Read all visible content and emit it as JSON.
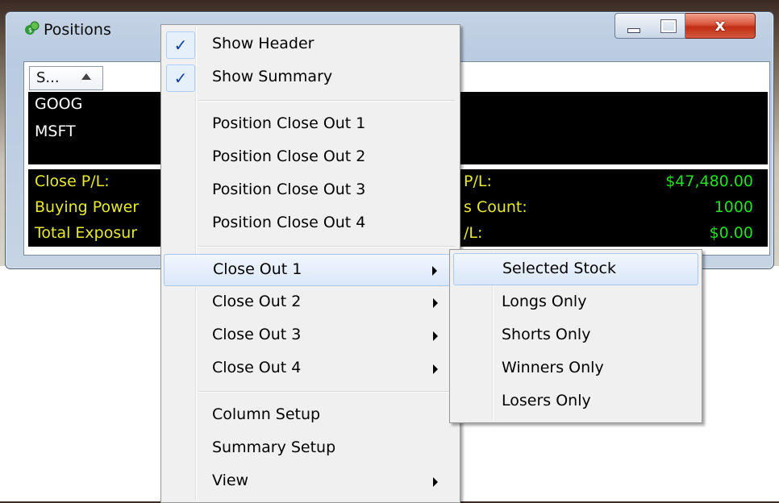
{
  "window": {
    "title": "Positions",
    "caption_close": "x",
    "column_header": "S...",
    "rows": [
      "GOOG",
      "MSFT"
    ],
    "summary": [
      {
        "label": "Close P/L:",
        "mid_label": "P/L:",
        "value": "$47,480.00"
      },
      {
        "label": "Buying Power",
        "mid_label": "s Count:",
        "value": "1000"
      },
      {
        "label": "Total Exposur",
        "mid_label": "/L:",
        "value": "$0.00"
      }
    ]
  },
  "menu": {
    "items": [
      {
        "label": "Show Header",
        "checked": true
      },
      {
        "label": "Show Summary",
        "checked": true
      },
      {
        "label": "Position Close Out 1"
      },
      {
        "label": "Position Close Out 2"
      },
      {
        "label": "Position Close Out 3"
      },
      {
        "label": "Position Close Out 4"
      },
      {
        "label": "Close Out 1",
        "submenu": true,
        "highlighted": true
      },
      {
        "label": "Close Out 2",
        "submenu": true
      },
      {
        "label": "Close Out 3",
        "submenu": true
      },
      {
        "label": "Close Out 4",
        "submenu": true
      },
      {
        "label": "Column Setup"
      },
      {
        "label": "Summary Setup"
      },
      {
        "label": "View",
        "submenu": true
      }
    ],
    "check_glyph": "✓"
  },
  "submenu": {
    "items": [
      {
        "label": "Selected Stock",
        "highlighted": true
      },
      {
        "label": "Longs Only"
      },
      {
        "label": "Shorts Only"
      },
      {
        "label": "Winners Only"
      },
      {
        "label": "Losers Only"
      }
    ]
  },
  "colors": {
    "summary_label": "#e6ea2b",
    "summary_value": "#22e022",
    "close_button": "#c8361c"
  }
}
